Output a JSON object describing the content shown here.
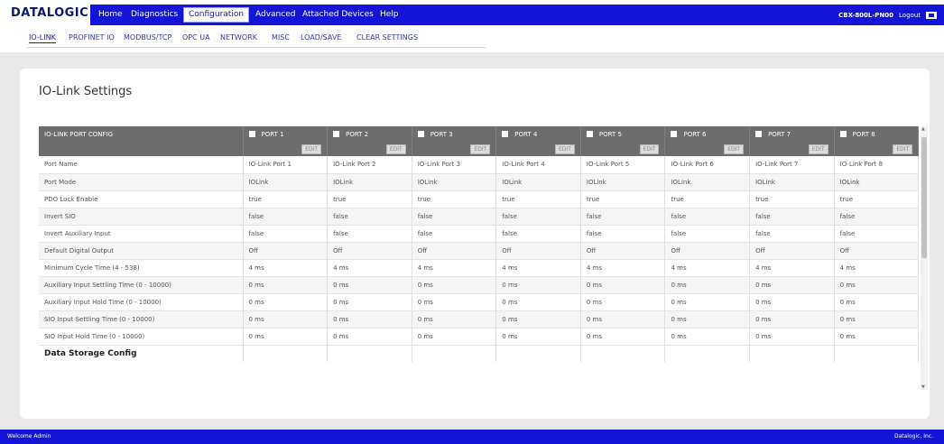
{
  "brand": {
    "logo_text": "DATALOGIC",
    "accent_color": "#1414d6"
  },
  "main_nav": {
    "items": [
      {
        "label": "Home"
      },
      {
        "label": "Diagnostics"
      },
      {
        "label": "Configuration",
        "active": true
      },
      {
        "label": "Advanced"
      },
      {
        "label": "Attached Devices"
      },
      {
        "label": "Help"
      }
    ],
    "device_name": "CBX-800L-PN00",
    "logout_label": "Logout",
    "language_icon": "flag-icon"
  },
  "sub_nav": {
    "tabs": [
      {
        "label": "IO-LINK",
        "active": true
      },
      {
        "label": "PROFINET IO"
      },
      {
        "label": "MODBUS/TCP"
      },
      {
        "label": "OPC UA"
      },
      {
        "label": "NETWORK"
      },
      {
        "label": "MISC"
      },
      {
        "label": "LOAD/SAVE"
      },
      {
        "label": "CLEAR SETTINGS"
      }
    ]
  },
  "page": {
    "title": "IO-Link Settings"
  },
  "settings_table": {
    "header_label": "IO-LINK PORT CONFIG",
    "edit_label": "EDIT",
    "ports": [
      "PORT 1",
      "PORT 2",
      "PORT 3",
      "PORT 4",
      "PORT 5",
      "PORT 6",
      "PORT 7",
      "PORT 8"
    ],
    "rows": [
      {
        "label": "Port Name",
        "values": [
          "IO-Link Port 1",
          "IO-Link Port 2",
          "IO-Link Port 3",
          "IO-Link Port 4",
          "IO-Link Port 5",
          "IO-Link Port 6",
          "IO-Link Port 7",
          "IO-Link Port 8"
        ]
      },
      {
        "label": "Port Mode",
        "values": [
          "IOLink",
          "IOLink",
          "IOLink",
          "IOLink",
          "IOLink",
          "IOLink",
          "IOLink",
          "IOLink"
        ]
      },
      {
        "label": "PDO Lock Enable",
        "values": [
          "true",
          "true",
          "true",
          "true",
          "true",
          "true",
          "true",
          "true"
        ]
      },
      {
        "label": "Invert SIO",
        "values": [
          "false",
          "false",
          "false",
          "false",
          "false",
          "false",
          "false",
          "false"
        ]
      },
      {
        "label": "Invert Auxiliary Input",
        "values": [
          "false",
          "false",
          "false",
          "false",
          "false",
          "false",
          "false",
          "false"
        ]
      },
      {
        "label": "Default Digital Output",
        "values": [
          "Off",
          "Off",
          "Off",
          "Off",
          "Off",
          "Off",
          "Off",
          "Off"
        ]
      },
      {
        "label": "Minimum Cycle Time (4 - 538)",
        "values": [
          "4 ms",
          "4 ms",
          "4 ms",
          "4 ms",
          "4 ms",
          "4 ms",
          "4 ms",
          "4 ms"
        ]
      },
      {
        "label": "Auxiliary Input Settling Time (0 - 10000)",
        "values": [
          "0 ms",
          "0 ms",
          "0 ms",
          "0 ms",
          "0 ms",
          "0 ms",
          "0 ms",
          "0 ms"
        ]
      },
      {
        "label": "Auxiliary Input Hold Time (0 - 10000)",
        "values": [
          "0 ms",
          "0 ms",
          "0 ms",
          "0 ms",
          "0 ms",
          "0 ms",
          "0 ms",
          "0 ms"
        ]
      },
      {
        "label": "SIO Input Settling Time (0 - 10000)",
        "values": [
          "0 ms",
          "0 ms",
          "0 ms",
          "0 ms",
          "0 ms",
          "0 ms",
          "0 ms",
          "0 ms"
        ]
      },
      {
        "label": "SIO Input Hold Time (0 - 10000)",
        "values": [
          "0 ms",
          "0 ms",
          "0 ms",
          "0 ms",
          "0 ms",
          "0 ms",
          "0 ms",
          "0 ms"
        ]
      }
    ],
    "section_label": "Data Storage Config"
  },
  "footer": {
    "left_text": "Welcome Admin",
    "right_text": "Datalogic, Inc."
  }
}
